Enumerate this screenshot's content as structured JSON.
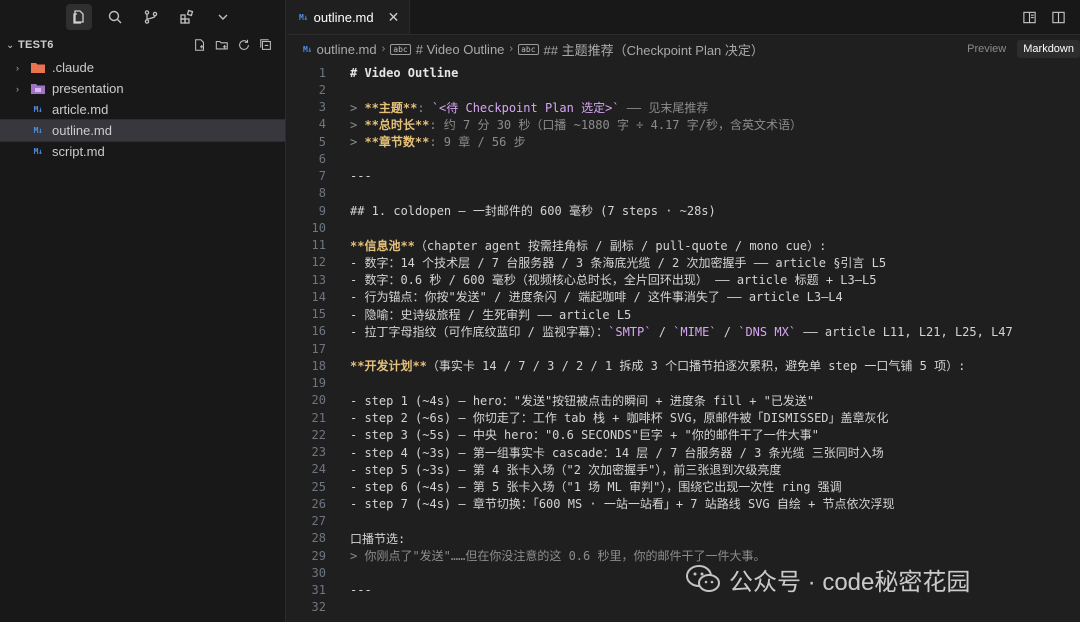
{
  "explorer": {
    "project": "TEST6",
    "items": [
      {
        "label": ".claude",
        "kind": "folder",
        "color": "#e8744f"
      },
      {
        "label": "presentation",
        "kind": "folder",
        "color": "#a074c4"
      },
      {
        "label": "article.md",
        "kind": "file"
      },
      {
        "label": "outline.md",
        "kind": "file",
        "selected": true
      },
      {
        "label": "script.md",
        "kind": "file"
      }
    ]
  },
  "tab": {
    "title": "outline.md",
    "close": "✕"
  },
  "breadcrumb": {
    "file": "outline.md",
    "h1": "# Video Outline",
    "h2": "## 主题推荐（Checkpoint Plan 决定）",
    "preview": "Preview",
    "markdown": "Markdown"
  },
  "watermark": {
    "text": "公众号 · code秘密花园"
  },
  "lines": [
    {
      "n": "1",
      "segs": [
        {
          "t": "# Video Outline",
          "c": "c-head"
        }
      ]
    },
    {
      "n": "2",
      "segs": []
    },
    {
      "n": "3",
      "segs": [
        {
          "t": "> ",
          "c": "c-quote"
        },
        {
          "t": "**主题**",
          "c": "c-bold"
        },
        {
          "t": ": ",
          "c": "c-quote"
        },
        {
          "t": "`<待 Checkpoint Plan 选定>`",
          "c": "c-code"
        },
        {
          "t": " —— 见末尾推荐",
          "c": "c-quote"
        }
      ]
    },
    {
      "n": "4",
      "segs": [
        {
          "t": "> ",
          "c": "c-quote"
        },
        {
          "t": "**总时长**",
          "c": "c-bold"
        },
        {
          "t": ": 约 7 分 30 秒（口播 ~1880 字 ÷ 4.17 字/秒，含英文术语）",
          "c": "c-quote"
        }
      ]
    },
    {
      "n": "5",
      "segs": [
        {
          "t": "> ",
          "c": "c-quote"
        },
        {
          "t": "**章节数**",
          "c": "c-bold"
        },
        {
          "t": ": 9 章 / 56 步",
          "c": "c-quote"
        }
      ]
    },
    {
      "n": "6",
      "segs": []
    },
    {
      "n": "7",
      "segs": [
        {
          "t": "---",
          "c": ""
        }
      ]
    },
    {
      "n": "8",
      "segs": []
    },
    {
      "n": "9",
      "segs": [
        {
          "t": "## 1. coldopen — 一封邮件的 600 毫秒 (7 steps · ~28s)",
          "c": ""
        }
      ]
    },
    {
      "n": "10",
      "segs": []
    },
    {
      "n": "11",
      "segs": [
        {
          "t": "**信息池**",
          "c": "c-bold"
        },
        {
          "t": "（chapter agent 按需挂角标 / 副标 / pull-quote / mono cue）:",
          "c": ""
        }
      ]
    },
    {
      "n": "12",
      "segs": [
        {
          "t": "- 数字：14 个技术层 / 7 台服务器 / 3 条海底光缆 / 2 次加密握手 —— article §引言 L5",
          "c": ""
        }
      ]
    },
    {
      "n": "13",
      "segs": [
        {
          "t": "- 数字：0.6 秒 / 600 毫秒（视频核心总时长，全片回环出现） —— article 标题 + L3–L5",
          "c": ""
        }
      ]
    },
    {
      "n": "14",
      "segs": [
        {
          "t": "- 行为锚点：你按\"发送\" / 进度条闪 / 端起咖啡 / 这件事消失了 —— article L3–L4",
          "c": ""
        }
      ]
    },
    {
      "n": "15",
      "segs": [
        {
          "t": "- 隐喻：史诗级旅程 / 生死审判 —— article L5",
          "c": ""
        }
      ]
    },
    {
      "n": "16",
      "segs": [
        {
          "t": "- 拉丁字母指纹（可作底纹蓝印 / 监视字幕）：",
          "c": ""
        },
        {
          "t": "`SMTP`",
          "c": "c-code"
        },
        {
          "t": " / ",
          "c": ""
        },
        {
          "t": "`MIME`",
          "c": "c-code"
        },
        {
          "t": " / ",
          "c": ""
        },
        {
          "t": "`DNS MX`",
          "c": "c-code"
        },
        {
          "t": " —— article L11, L21, L25, L47",
          "c": ""
        }
      ]
    },
    {
      "n": "17",
      "segs": []
    },
    {
      "n": "18",
      "segs": [
        {
          "t": "**开发计划**",
          "c": "c-bold"
        },
        {
          "t": "（事实卡 14 / 7 / 3 / 2 / 1 拆成 3 个口播节拍逐次累积，避免单 step 一口气铺 5 项）:",
          "c": ""
        }
      ]
    },
    {
      "n": "19",
      "segs": []
    },
    {
      "n": "20",
      "segs": [
        {
          "t": "- step 1 (~4s) — hero：\"发送\"按钮被点击的瞬间 + 进度条 fill + \"已发送\"",
          "c": ""
        }
      ]
    },
    {
      "n": "21",
      "segs": [
        {
          "t": "- step 2 (~6s) — 你切走了：工作 tab 栈 + 咖啡杯 SVG，原邮件被「DISMISSED」盖章灰化",
          "c": ""
        }
      ]
    },
    {
      "n": "22",
      "segs": [
        {
          "t": "- step 3 (~5s) — 中央 hero：\"0.6 SECONDS\"巨字 + \"你的邮件干了一件大事\"",
          "c": ""
        }
      ]
    },
    {
      "n": "23",
      "segs": [
        {
          "t": "- step 4 (~3s) — 第一组事实卡 cascade：14 层 / 7 台服务器 / 3 条光缆 三张同时入场",
          "c": ""
        }
      ]
    },
    {
      "n": "24",
      "segs": [
        {
          "t": "- step 5 (~3s) — 第 4 张卡入场（\"2 次加密握手\"），前三张退到次级亮度",
          "c": ""
        }
      ]
    },
    {
      "n": "25",
      "segs": [
        {
          "t": "- step 6 (~4s) — 第 5 张卡入场（\"1 场 ML 审判\"），围绕它出现一次性 ring 强调",
          "c": ""
        }
      ]
    },
    {
      "n": "26",
      "segs": [
        {
          "t": "- step 7 (~4s) — 章节切换：「600 MS · 一站一站看」+ 7 站路线 SVG 自绘 + 节点依次浮现",
          "c": ""
        }
      ]
    },
    {
      "n": "27",
      "segs": []
    },
    {
      "n": "28",
      "segs": [
        {
          "t": "口播节选:",
          "c": ""
        }
      ]
    },
    {
      "n": "29",
      "segs": [
        {
          "t": "> 你刚点了\"发送\"……但在你没注意的这 0.6 秒里，你的邮件干了一件大事。",
          "c": "c-quote"
        }
      ]
    },
    {
      "n": "30",
      "segs": []
    },
    {
      "n": "31",
      "segs": [
        {
          "t": "---",
          "c": ""
        }
      ]
    },
    {
      "n": "32",
      "segs": []
    }
  ]
}
